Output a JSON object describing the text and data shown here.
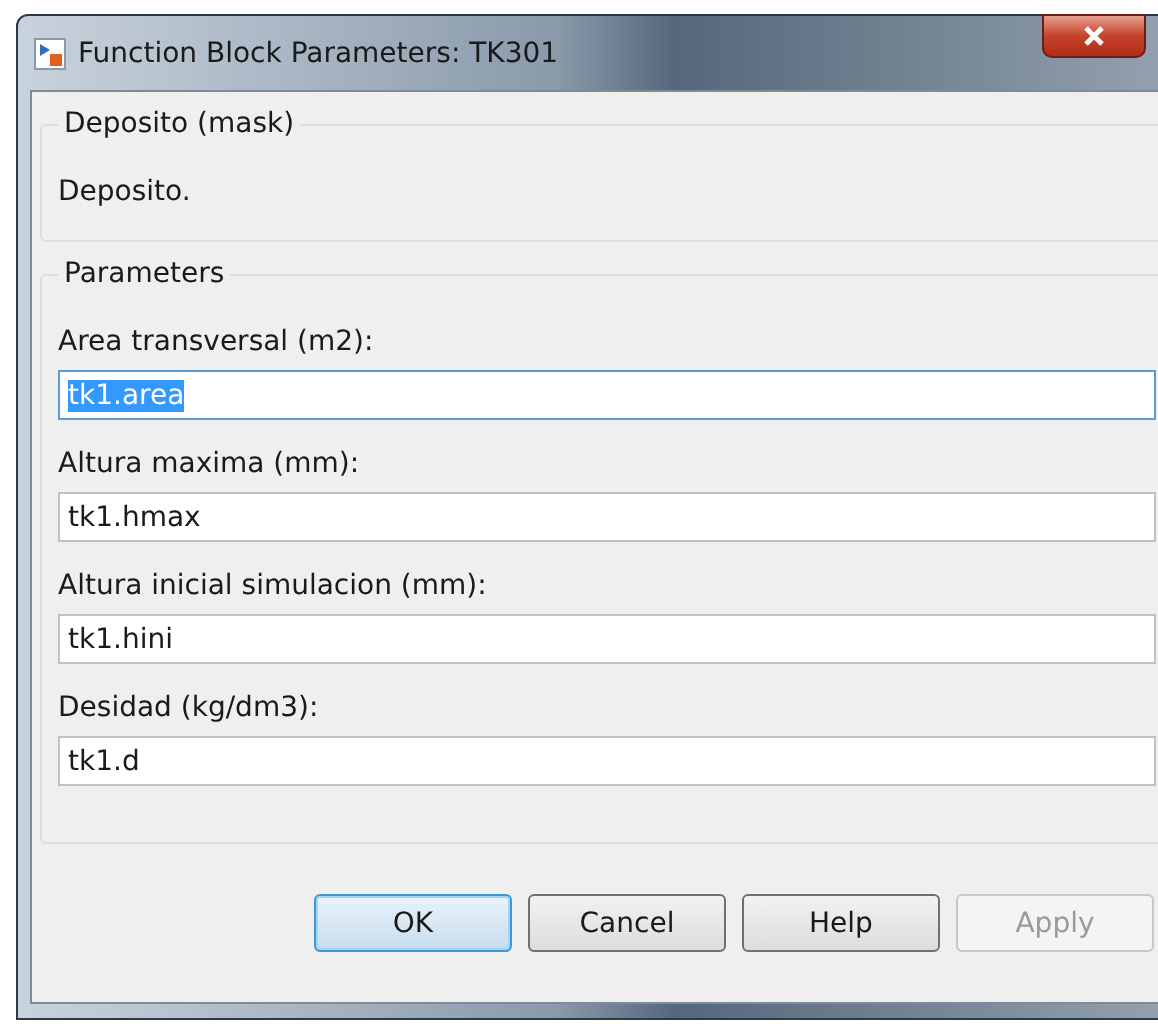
{
  "window": {
    "title": "Function Block Parameters: TK301"
  },
  "mask": {
    "legend": "Deposito (mask)",
    "description": "Deposito."
  },
  "parameters": {
    "legend": "Parameters",
    "fields": [
      {
        "label": "Area transversal (m2):",
        "value": "tk1.area",
        "focused": true
      },
      {
        "label": "Altura maxima (mm):",
        "value": "tk1.hmax",
        "focused": false
      },
      {
        "label": "Altura inicial simulacion (mm):",
        "value": "tk1.hini",
        "focused": false
      },
      {
        "label": "Desidad (kg/dm3):",
        "value": "tk1.d",
        "focused": false
      }
    ]
  },
  "buttons": [
    {
      "label": "OK",
      "default": true,
      "disabled": false
    },
    {
      "label": "Cancel",
      "default": false,
      "disabled": false
    },
    {
      "label": "Help",
      "default": false,
      "disabled": false
    },
    {
      "label": "Apply",
      "default": false,
      "disabled": true
    }
  ]
}
